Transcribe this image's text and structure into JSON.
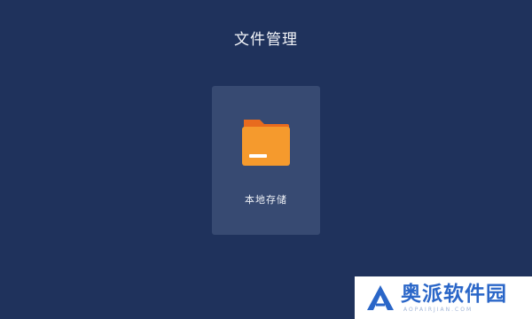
{
  "header": {
    "title": "文件管理"
  },
  "storage": {
    "label": "本地存储",
    "icon": "folder-icon",
    "icon_color": "#f59a2d"
  },
  "watermark": {
    "brand": "奥派软件园",
    "subtitle": "AOPAIRJIAN.COM",
    "color": "#2a66c8"
  },
  "colors": {
    "background": "#1f325c",
    "card": "#374a72"
  }
}
